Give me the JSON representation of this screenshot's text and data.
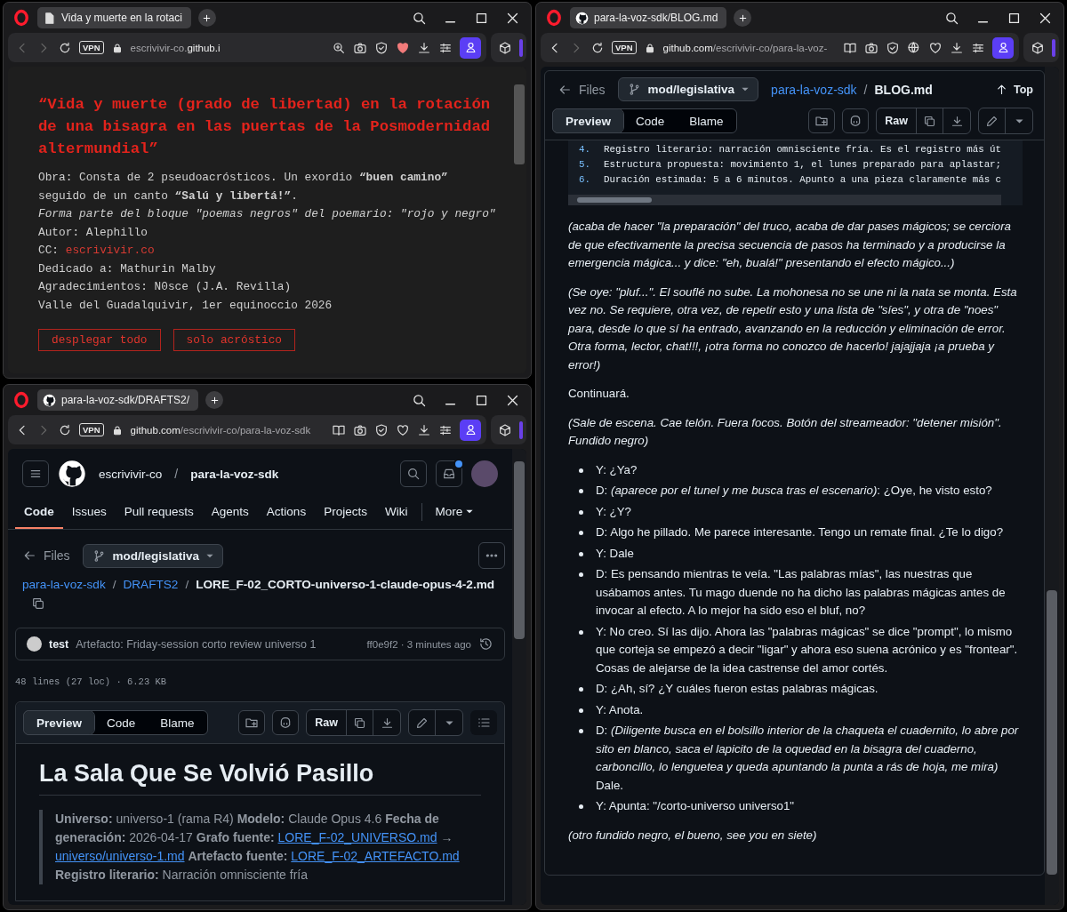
{
  "windows": [
    {
      "kind": "poem",
      "tab": {
        "title": "Vida y muerte en la rotaci"
      },
      "can_go_back": false,
      "vpn": "VPN",
      "url": {
        "prefix": "escrivivir-co.",
        "domain": "github.i"
      },
      "tools": [
        {
          "kind": "zoom",
          "on": false
        },
        {
          "kind": "snapshot",
          "on": false
        },
        {
          "kind": "shield",
          "on": false
        },
        {
          "kind": "heart",
          "on": true
        },
        {
          "kind": "download",
          "on": false
        },
        {
          "kind": "setup",
          "on": false
        }
      ],
      "page": {
        "title": "“Vida y muerte (grado de libertad) en la rotación de una bisagra en las puertas de la Posmodernidad altermundial”",
        "lines": [
          {
            "text": "Obra: Consta de 2 pseudoacrósticos. Un exordio **“buen camino”** seguido de un canto **“Salú y libertá!”**.",
            "italic": false
          },
          {
            "text": "Forma parte del bloque \"poemas negros\" del poemario: \"rojo y negro\"",
            "italic": true
          },
          {
            "text": "Autor: Alephillo",
            "italic": false
          },
          {
            "text": "CC:",
            "italic": false,
            "link": "escrivivir.co"
          },
          {
            "text": "Dedicado a: Mathurin Malby",
            "italic": false
          },
          {
            "text": "Agradecimientos: N0sce (J.A. Revilla)",
            "italic": false
          },
          {
            "text": "Valle del Guadalquivir, 1er equinoccio 2026",
            "italic": false
          }
        ],
        "buttons": [
          "desplegar todo",
          "solo acróstico"
        ]
      }
    },
    {
      "kind": "github-blog",
      "tab": {
        "title": "para-la-voz-sdk/BLOG.md"
      },
      "can_go_back": true,
      "vpn": "VPN",
      "url": {
        "domain": "github.com",
        "path": "/escrivivir-co/para-la-voz-"
      },
      "tools": [
        {
          "kind": "reader",
          "on": false
        },
        {
          "kind": "snapshot",
          "on": false
        },
        {
          "kind": "shield",
          "on": false
        },
        {
          "kind": "translate",
          "on": false
        },
        {
          "kind": "heart",
          "on": false
        },
        {
          "kind": "download",
          "on": false
        },
        {
          "kind": "setup",
          "on": false
        }
      ],
      "page": {
        "files": "Files",
        "branch": "mod/legislativa",
        "breadcrumb": [
          "para-la-voz-sdk"
        ],
        "separator": "/",
        "filename": "BLOG.md",
        "top": "Top",
        "view_tabs": [
          {
            "label": "Preview",
            "selected": true
          },
          {
            "label": "Code",
            "selected": false
          },
          {
            "label": "Blame",
            "selected": false
          }
        ],
        "raw": "Raw",
        "code_lines": [
          {
            "number": "4.",
            "text": "Registro literario: narración omnisciente fría. Es el registro más út"
          },
          {
            "number": "5.",
            "text": "Estructura propuesta: movimiento 1, el lunes preparado para aplastar;"
          },
          {
            "number": "6.",
            "text": "Duración estimada: 5 a 6 minutos. Apunto a una pieza claramente más c"
          }
        ],
        "blocks": [
          {
            "kind": "paragraph",
            "italic": true,
            "text": "(acaba de hacer \"la preparación\" del truco, acaba de dar pases mágicos; se cerciora de que efectivamente la precisa secuencia de pasos ha terminado y a producirse la emergencia mágica... y dice: \"eh, bualá!\" presentando el efecto mágico...)"
          },
          {
            "kind": "paragraph",
            "italic": true,
            "text": "(Se oye: \"pluf...\". El souflé no sube. La mohonesa no se une ni la nata se monta. Esta vez no. Se requiere, otra vez, de repetir esto y una lista de \"síes\", y otra de \"noes\" para, desde lo que sí ha entrado, avanzando en la reducción y eliminación de error. Otra forma, lector, chat!!!, ¡otra forma no conozco de hacerlo! jajajjaja ¡a prueba y error!)"
          },
          {
            "kind": "paragraph",
            "italic": false,
            "text": "Continuará."
          },
          {
            "kind": "paragraph",
            "italic": true,
            "text": "(Sale de escena. Cae telón. Fuera focos. Botón del streameador: \"detener misión\". Fundido negro)"
          },
          {
            "kind": "list",
            "items": [
              "Y: ¿Ya?",
              "D: *(aparece por el tunel y me busca tras el escenario)*: ¿Oye, he visto esto?",
              "Y: ¿Y?",
              "D: Algo he pillado. Me parece interesante. Tengo un remate final. ¿Te lo digo?",
              "Y: Dale",
              "D: Es pensando mientras te veía. \"Las palabras mías\", las nuestras que usábamos antes. Tu mago duende no ha dicho las palabras mágicas antes de invocar al efecto. A lo mejor ha sido eso el bluf, no?",
              "Y: No creo. Sí las dijo. Ahora las \"palabras mágicas\" se dice \"prompt\", lo mismo que corteja se empezó a decir \"ligar\" y ahora eso suena acrónico y es \"frontear\". Cosas de alejarse de la idea castrense del amor cortés.",
              "D: ¿Ah, sí? ¿Y cuáles fueron estas palabras mágicas.",
              "Y: Anota.",
              "D: *(Diligente busca en el bolsillo interior de la chaqueta el cuadernito, lo abre por sito en blanco, saca el lapicito de la oquedad en la bisagra del cuaderno, carboncillo, lo lenguetea y queda apuntando la punta a rás de hoja, me mira)* Dale.",
              "Y: Apunta: \"/corto-universo universo1\""
            ]
          },
          {
            "kind": "paragraph",
            "italic": true,
            "text": "(otro fundido negro, el bueno, see you en siete)"
          }
        ]
      }
    },
    {
      "kind": "github-file",
      "tab": {
        "title": "para-la-voz-sdk/DRAFTS2/"
      },
      "can_go_back": true,
      "vpn": "VPN",
      "url": {
        "domain": "github.com",
        "path": "/escrivivir-co/para-la-voz-sdk"
      },
      "tools": [
        {
          "kind": "reader",
          "on": false
        },
        {
          "kind": "snapshot",
          "on": false
        },
        {
          "kind": "shield",
          "on": false
        },
        {
          "kind": "heart",
          "on": false
        },
        {
          "kind": "download",
          "on": false
        },
        {
          "kind": "setup",
          "on": false
        }
      ],
      "page": {
        "owner": "escrivivir-co",
        "separator": "/",
        "repo": "para-la-voz-sdk",
        "inbox_unread": true,
        "nav": [
          {
            "label": "Code",
            "selected": true
          },
          {
            "label": "Issues",
            "selected": false
          },
          {
            "label": "Pull requests",
            "selected": false
          },
          {
            "label": "Agents",
            "selected": false
          },
          {
            "label": "Actions",
            "selected": false
          },
          {
            "label": "Projects",
            "selected": false
          },
          {
            "label": "Wiki",
            "selected": false
          }
        ],
        "more": "More",
        "files": "Files",
        "branch": "mod/legislativa",
        "breadcrumb": [
          "para-la-voz-sdk",
          "DRAFTS2"
        ],
        "filename": "LORE_F-02_CORTO-universo-1-claude-opus-4-2.md",
        "commit": {
          "author": "test",
          "message": "Artefacto: Friday-session corto review universo 1",
          "meta": "ff0e9f2 · 3 minutes ago"
        },
        "stats": "48 lines (27 loc) · 6.23 KB",
        "view_tabs": [
          {
            "label": "Preview",
            "selected": true
          },
          {
            "label": "Code",
            "selected": false
          },
          {
            "label": "Blame",
            "selected": false
          }
        ],
        "raw": "Raw",
        "heading": "La Sala Que Se Volvió Pasillo",
        "meta": [
          {
            "label": "Universo:",
            "value": "universo-1 (rama R4)"
          },
          {
            "label": "Modelo:",
            "value": "Claude Opus 4.6"
          },
          {
            "label": "Fecha de generación:",
            "value": "2026-04-17"
          },
          {
            "label": "Grafo fuente:",
            "links": [
              "LORE_F-02_UNIVERSO.md",
              "universo/universo-1.md"
            ],
            "link_separator": "→"
          },
          {
            "label": "Artefacto fuente:",
            "links": [
              "LORE_F-02_ARTEFACTO.md"
            ]
          },
          {
            "label": "Registro literario:",
            "value": "Narración omnisciente fría"
          }
        ]
      }
    }
  ]
}
